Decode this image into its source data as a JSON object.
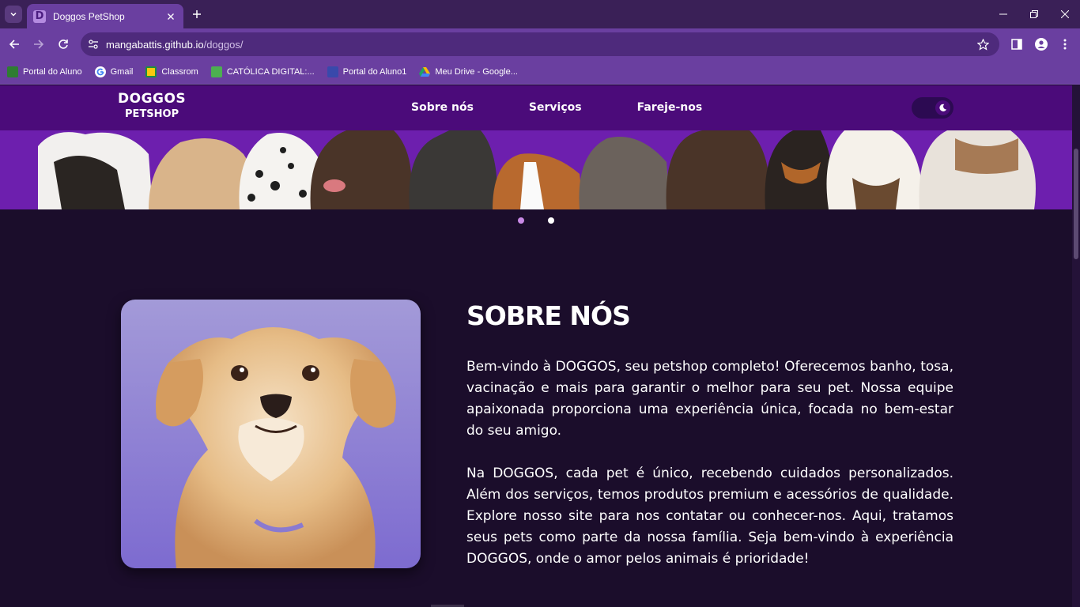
{
  "browser": {
    "tab_title": "Doggos PetShop",
    "tab_favicon_letter": "D",
    "url_domain": "mangabattis.github.io",
    "url_path": "/doggos/",
    "bookmarks": [
      {
        "label": "Portal do Aluno",
        "icon": "portal-icon",
        "color": "#2e7d32"
      },
      {
        "label": "Gmail",
        "icon": "google-icon",
        "color": "#ffffff"
      },
      {
        "label": "Classrom",
        "icon": "classroom-icon",
        "color": "#f9c80e"
      },
      {
        "label": "CATÓLICA DIGITAL:...",
        "icon": "catolica-icon",
        "color": "#4caf50"
      },
      {
        "label": "Portal do Aluno1",
        "icon": "portal-icon",
        "color": "#3949ab"
      },
      {
        "label": "Meu Drive - Google...",
        "icon": "drive-icon",
        "color": "#fbbc04"
      }
    ]
  },
  "site": {
    "logo_line1": "DOGGOS",
    "logo_line2": "PETSHOP",
    "nav": [
      "Sobre nós",
      "Serviços",
      "Fareje-nos"
    ],
    "theme_icon": "moon-icon",
    "carousel": {
      "slides": 2,
      "active_index": 0
    },
    "about": {
      "title": "SOBRE NÓS",
      "paragraph1": "Bem-vindo à DOGGOS, seu petshop completo! Oferecemos banho, tosa, vacinação e mais para garantir o melhor para seu pet. Nossa equipe apaixonada proporciona uma experiência única, focada no bem-estar do seu amigo.",
      "paragraph2": "Na DOGGOS, cada pet é único, recebendo cuidados personalizados. Além dos serviços, temos produtos premium e acessórios de qualidade. Explore nosso site para nos contatar ou conhecer-nos. Aqui, tratamos seus pets como parte da nossa família. Seja bem-vindo à experiência DOGGOS, onde o amor pelos animais é prioridade!"
    }
  },
  "colors": {
    "page_bg": "#1b0d2b",
    "header_bg": "#4b0b7a",
    "banner_bg": "#6d1fae",
    "dot_active": "#c98ae6",
    "dot_inactive": "#ffffff"
  }
}
